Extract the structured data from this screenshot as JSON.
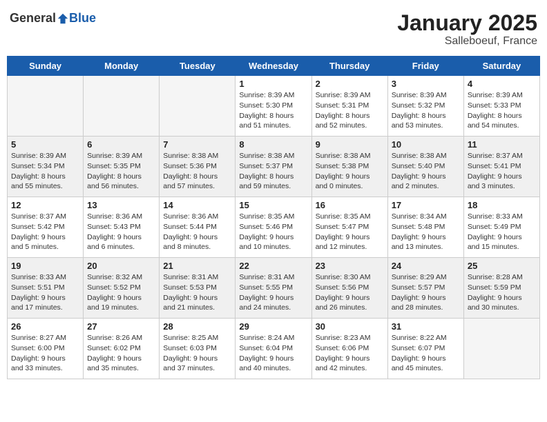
{
  "header": {
    "logo_general": "General",
    "logo_blue": "Blue",
    "month": "January 2025",
    "location": "Salleboeuf, France"
  },
  "weekdays": [
    "Sunday",
    "Monday",
    "Tuesday",
    "Wednesday",
    "Thursday",
    "Friday",
    "Saturday"
  ],
  "weeks": [
    [
      {
        "day": "",
        "info": ""
      },
      {
        "day": "",
        "info": ""
      },
      {
        "day": "",
        "info": ""
      },
      {
        "day": "1",
        "info": "Sunrise: 8:39 AM\nSunset: 5:30 PM\nDaylight: 8 hours\nand 51 minutes."
      },
      {
        "day": "2",
        "info": "Sunrise: 8:39 AM\nSunset: 5:31 PM\nDaylight: 8 hours\nand 52 minutes."
      },
      {
        "day": "3",
        "info": "Sunrise: 8:39 AM\nSunset: 5:32 PM\nDaylight: 8 hours\nand 53 minutes."
      },
      {
        "day": "4",
        "info": "Sunrise: 8:39 AM\nSunset: 5:33 PM\nDaylight: 8 hours\nand 54 minutes."
      }
    ],
    [
      {
        "day": "5",
        "info": "Sunrise: 8:39 AM\nSunset: 5:34 PM\nDaylight: 8 hours\nand 55 minutes."
      },
      {
        "day": "6",
        "info": "Sunrise: 8:39 AM\nSunset: 5:35 PM\nDaylight: 8 hours\nand 56 minutes."
      },
      {
        "day": "7",
        "info": "Sunrise: 8:38 AM\nSunset: 5:36 PM\nDaylight: 8 hours\nand 57 minutes."
      },
      {
        "day": "8",
        "info": "Sunrise: 8:38 AM\nSunset: 5:37 PM\nDaylight: 8 hours\nand 59 minutes."
      },
      {
        "day": "9",
        "info": "Sunrise: 8:38 AM\nSunset: 5:38 PM\nDaylight: 9 hours\nand 0 minutes."
      },
      {
        "day": "10",
        "info": "Sunrise: 8:38 AM\nSunset: 5:40 PM\nDaylight: 9 hours\nand 2 minutes."
      },
      {
        "day": "11",
        "info": "Sunrise: 8:37 AM\nSunset: 5:41 PM\nDaylight: 9 hours\nand 3 minutes."
      }
    ],
    [
      {
        "day": "12",
        "info": "Sunrise: 8:37 AM\nSunset: 5:42 PM\nDaylight: 9 hours\nand 5 minutes."
      },
      {
        "day": "13",
        "info": "Sunrise: 8:36 AM\nSunset: 5:43 PM\nDaylight: 9 hours\nand 6 minutes."
      },
      {
        "day": "14",
        "info": "Sunrise: 8:36 AM\nSunset: 5:44 PM\nDaylight: 9 hours\nand 8 minutes."
      },
      {
        "day": "15",
        "info": "Sunrise: 8:35 AM\nSunset: 5:46 PM\nDaylight: 9 hours\nand 10 minutes."
      },
      {
        "day": "16",
        "info": "Sunrise: 8:35 AM\nSunset: 5:47 PM\nDaylight: 9 hours\nand 12 minutes."
      },
      {
        "day": "17",
        "info": "Sunrise: 8:34 AM\nSunset: 5:48 PM\nDaylight: 9 hours\nand 13 minutes."
      },
      {
        "day": "18",
        "info": "Sunrise: 8:33 AM\nSunset: 5:49 PM\nDaylight: 9 hours\nand 15 minutes."
      }
    ],
    [
      {
        "day": "19",
        "info": "Sunrise: 8:33 AM\nSunset: 5:51 PM\nDaylight: 9 hours\nand 17 minutes."
      },
      {
        "day": "20",
        "info": "Sunrise: 8:32 AM\nSunset: 5:52 PM\nDaylight: 9 hours\nand 19 minutes."
      },
      {
        "day": "21",
        "info": "Sunrise: 8:31 AM\nSunset: 5:53 PM\nDaylight: 9 hours\nand 21 minutes."
      },
      {
        "day": "22",
        "info": "Sunrise: 8:31 AM\nSunset: 5:55 PM\nDaylight: 9 hours\nand 24 minutes."
      },
      {
        "day": "23",
        "info": "Sunrise: 8:30 AM\nSunset: 5:56 PM\nDaylight: 9 hours\nand 26 minutes."
      },
      {
        "day": "24",
        "info": "Sunrise: 8:29 AM\nSunset: 5:57 PM\nDaylight: 9 hours\nand 28 minutes."
      },
      {
        "day": "25",
        "info": "Sunrise: 8:28 AM\nSunset: 5:59 PM\nDaylight: 9 hours\nand 30 minutes."
      }
    ],
    [
      {
        "day": "26",
        "info": "Sunrise: 8:27 AM\nSunset: 6:00 PM\nDaylight: 9 hours\nand 33 minutes."
      },
      {
        "day": "27",
        "info": "Sunrise: 8:26 AM\nSunset: 6:02 PM\nDaylight: 9 hours\nand 35 minutes."
      },
      {
        "day": "28",
        "info": "Sunrise: 8:25 AM\nSunset: 6:03 PM\nDaylight: 9 hours\nand 37 minutes."
      },
      {
        "day": "29",
        "info": "Sunrise: 8:24 AM\nSunset: 6:04 PM\nDaylight: 9 hours\nand 40 minutes."
      },
      {
        "day": "30",
        "info": "Sunrise: 8:23 AM\nSunset: 6:06 PM\nDaylight: 9 hours\nand 42 minutes."
      },
      {
        "day": "31",
        "info": "Sunrise: 8:22 AM\nSunset: 6:07 PM\nDaylight: 9 hours\nand 45 minutes."
      },
      {
        "day": "",
        "info": ""
      }
    ]
  ]
}
